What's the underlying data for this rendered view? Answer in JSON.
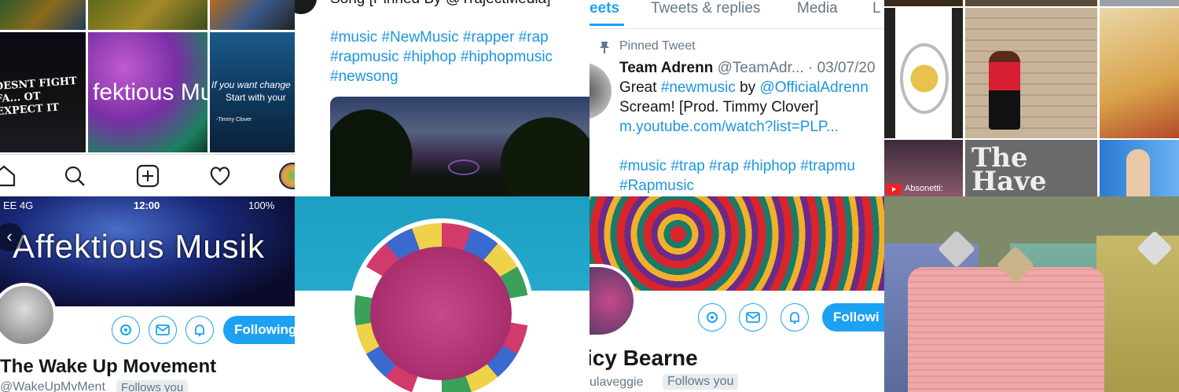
{
  "tile_instagram": {
    "overlay_text_left": "OESNT FIGHT FA... OT EXPECT IT",
    "overlay_text_mid": "fektious Mu",
    "overlay_text_right_1": "If you want change",
    "overlay_text_right_2": "Start with your",
    "overlay_text_right_3": "-Timmy Clover"
  },
  "tile_tweet": {
    "header_line": "Song [Pinned By @TrajectMedia]",
    "hashtags_1": "#music #NewMusic #rapper #rap",
    "hashtags_2": "#rapmusic #hiphop #hiphopmusic",
    "hashtags_3": "#newsong"
  },
  "tile_tabs": {
    "tabs": [
      {
        "label": "eets"
      },
      {
        "label": "Tweets & replies"
      },
      {
        "label": "Media"
      },
      {
        "label": "L"
      }
    ],
    "pinned_label": "Pinned Tweet",
    "author_name": "Team Adrenn",
    "author_meta": "@TeamAdr... · 03/07/20",
    "line1_prefix": "Great ",
    "line1_tag": "#newmusic",
    "line1_by": " by ",
    "line1_handle": "@OfficialAdrenn",
    "line2": "Scream! [Prod. Timmy Clover]",
    "link": "m.youtube.com/watch?list=PLP...",
    "tags1": "#music #trap #rap #hiphop #trapmu",
    "tags2": "#Rapmusic"
  },
  "tile_photos": {
    "banner_text": "The Have",
    "video_label": "Absonetti:"
  },
  "tile_profile_1": {
    "carrier": "EE  4G",
    "time": "12:00",
    "battery": "100%",
    "banner_text": "Affektious Musik",
    "follow_label": "Following",
    "name": "The Wake Up Movement",
    "handle": "@WakeUpMvMent",
    "follows_you": "Follows you"
  },
  "tile_profile_2": {
    "follow_label": "Followi",
    "name": "icy Bearne",
    "handle": "ulaveggie",
    "follows_you": "Follows you"
  }
}
